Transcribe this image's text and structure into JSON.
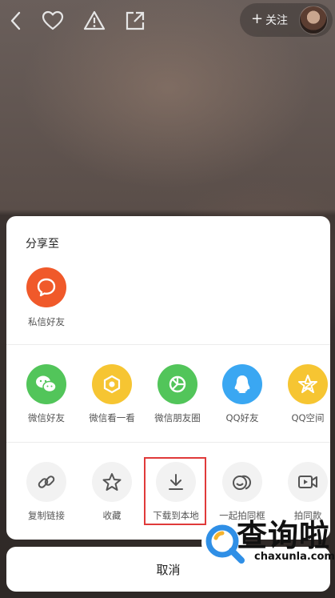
{
  "top_bar": {
    "follow_plus": "+",
    "follow_label": "关注"
  },
  "share_sheet": {
    "title": "分享至",
    "row1": [
      {
        "label": "私信好友",
        "icon": "message-bubble-icon",
        "color": "#f0592a"
      }
    ],
    "row2": [
      {
        "label": "微信好友",
        "icon": "wechat-icon",
        "color": "#52c55a"
      },
      {
        "label": "微信看一看",
        "icon": "wechat-look-icon",
        "color": "#f6c532"
      },
      {
        "label": "微信朋友圈",
        "icon": "wechat-moments-icon",
        "color": "#52c55a"
      },
      {
        "label": "QQ好友",
        "icon": "qq-icon",
        "color": "#3aa7f2"
      },
      {
        "label": "QQ空间",
        "icon": "qzone-icon",
        "color": "#f6c532"
      }
    ],
    "row3": [
      {
        "label": "复制链接",
        "icon": "link-icon"
      },
      {
        "label": "收藏",
        "icon": "star-icon"
      },
      {
        "label": "下载到本地",
        "icon": "download-icon"
      },
      {
        "label": "一起拍同框",
        "icon": "duet-icon"
      },
      {
        "label": "拍同款",
        "icon": "video-camera-icon"
      }
    ]
  },
  "cancel_label": "取消",
  "watermark": {
    "title": "查询啦",
    "url": "chaxunla.com"
  },
  "colors": {
    "highlight": "#e03a3a"
  }
}
